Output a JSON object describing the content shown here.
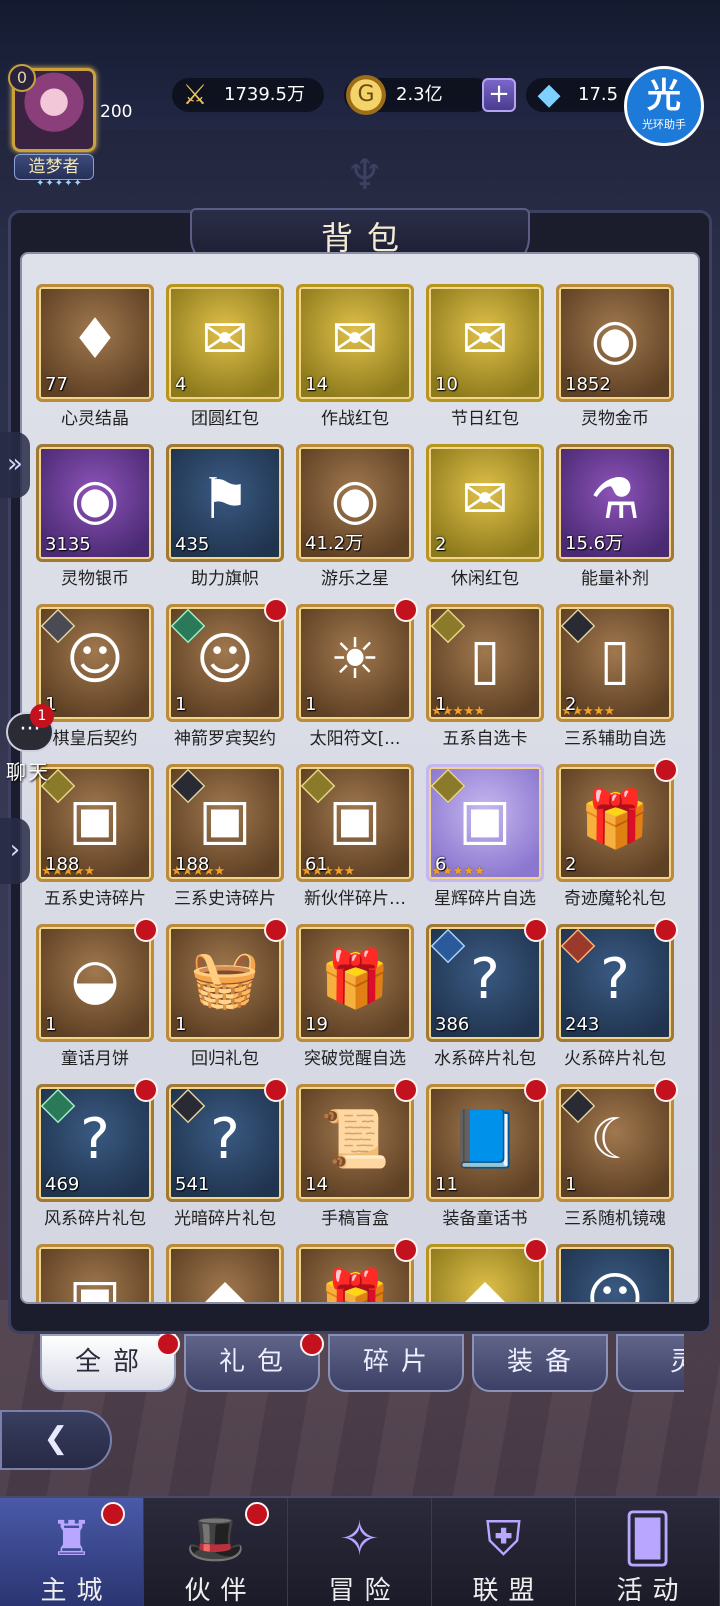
{
  "player": {
    "level": "0",
    "vip": "200",
    "title": "造梦者",
    "title_stars": "✦✦✦✦✦"
  },
  "resources": {
    "power": "1739.5万",
    "gold": "2.3亿",
    "gems": "17.5"
  },
  "helper_badge": {
    "glyph": "光",
    "label": "光环助手"
  },
  "panel": {
    "title": "背包"
  },
  "chat": {
    "count": "1",
    "label": "聊天"
  },
  "items": [
    {
      "label": "心灵结晶",
      "qty": "77",
      "style": "brown",
      "icon": "♦",
      "icon_name": "crystal-icon"
    },
    {
      "label": "团圆红包",
      "qty": "4",
      "style": "gold",
      "icon": "✉",
      "icon_name": "red-envelope-icon"
    },
    {
      "label": "作战红包",
      "qty": "14",
      "style": "gold",
      "icon": "✉",
      "icon_name": "red-envelope-icon"
    },
    {
      "label": "节日红包",
      "qty": "10",
      "style": "gold",
      "icon": "✉",
      "icon_name": "red-envelope-icon"
    },
    {
      "label": "灵物金币",
      "qty": "1852",
      "style": "brown",
      "icon": "◉",
      "icon_name": "gold-coin-icon"
    },
    {
      "label": "灵物银币",
      "qty": "3135",
      "style": "purple",
      "icon": "◉",
      "icon_name": "silver-coin-icon"
    },
    {
      "label": "助力旗帜",
      "qty": "435",
      "style": "blue",
      "icon": "⚑",
      "icon_name": "flag-icon"
    },
    {
      "label": "游乐之星",
      "qty": "41.2万",
      "style": "brown",
      "icon": "◉",
      "icon_name": "star-coin-icon"
    },
    {
      "label": "休闲红包",
      "qty": "2",
      "style": "gold",
      "icon": "✉",
      "icon_name": "red-envelope-icon"
    },
    {
      "label": "能量补剂",
      "qty": "15.6万",
      "style": "purple",
      "icon": "⚗",
      "icon_name": "potion-icon"
    },
    {
      "label": "棋皇后契约",
      "qty": "1",
      "style": "brown",
      "icon": "☺",
      "icon_name": "contract-icon",
      "badge": "gray"
    },
    {
      "label": "神箭罗宾契约",
      "qty": "1",
      "style": "brown",
      "icon": "☺",
      "icon_name": "contract-icon",
      "badge": "green",
      "dot": true
    },
    {
      "label": "太阳符文[...",
      "qty": "1",
      "style": "brown",
      "icon": "☀",
      "icon_name": "sun-rune-icon",
      "dot": true
    },
    {
      "label": "五系自选卡",
      "qty": "1",
      "style": "brown",
      "icon": "▯",
      "icon_name": "card-icon",
      "badge": "gold",
      "stars": "★★★★★"
    },
    {
      "label": "三系辅助自选",
      "qty": "2",
      "style": "brown",
      "icon": "▯",
      "icon_name": "card-icon",
      "badge": "dark",
      "stars": "★★★★★"
    },
    {
      "label": "五系史诗碎片",
      "qty": "188",
      "style": "brown",
      "icon": "▣",
      "icon_name": "chest-icon",
      "badge": "gold",
      "stars": "★★★★★"
    },
    {
      "label": "三系史诗碎片",
      "qty": "188",
      "style": "brown",
      "icon": "▣",
      "icon_name": "chest-icon",
      "badge": "dark",
      "stars": "★★★★★"
    },
    {
      "label": "新伙伴碎片…",
      "qty": "61",
      "style": "brown",
      "icon": "▣",
      "icon_name": "chest-icon",
      "badge": "gold",
      "stars": "★★★★★"
    },
    {
      "label": "星辉碎片自选",
      "qty": "6",
      "style": "lavender",
      "icon": "▣",
      "icon_name": "chest-icon",
      "badge": "gold",
      "stars": "★★★★★"
    },
    {
      "label": "奇迹魔轮礼包",
      "qty": "2",
      "style": "brown",
      "icon": "🎁",
      "icon_name": "gift-box-icon",
      "dot": true
    },
    {
      "label": "童话月饼",
      "qty": "1",
      "style": "brown",
      "icon": "◒",
      "icon_name": "mooncake-icon",
      "dot": true
    },
    {
      "label": "回归礼包",
      "qty": "1",
      "style": "brown",
      "icon": "🧺",
      "icon_name": "basket-icon",
      "dot": true
    },
    {
      "label": "突破觉醒自选",
      "qty": "19",
      "style": "brown",
      "icon": "🎁",
      "icon_name": "gift-box-icon"
    },
    {
      "label": "水系碎片礼包",
      "qty": "386",
      "style": "blue",
      "icon": "?",
      "icon_name": "mystery-shard-icon",
      "badge": "blue",
      "dot": true
    },
    {
      "label": "火系碎片礼包",
      "qty": "243",
      "style": "blue",
      "icon": "?",
      "icon_name": "mystery-shard-icon",
      "badge": "red",
      "dot": true
    },
    {
      "label": "风系碎片礼包",
      "qty": "469",
      "style": "blue",
      "icon": "?",
      "icon_name": "mystery-shard-icon",
      "badge": "green",
      "dot": true
    },
    {
      "label": "光暗碎片礼包",
      "qty": "541",
      "style": "blue",
      "icon": "?",
      "icon_name": "mystery-shard-icon",
      "badge": "dark",
      "dot": true
    },
    {
      "label": "手稿盲盒",
      "qty": "14",
      "style": "brown",
      "icon": "📜",
      "icon_name": "scroll-icon",
      "dot": true
    },
    {
      "label": "装备童话书",
      "qty": "11",
      "style": "brown",
      "icon": "📘",
      "icon_name": "book-icon",
      "dot": true
    },
    {
      "label": "三系随机镜魂",
      "qty": "1",
      "style": "brown",
      "icon": "☾",
      "icon_name": "mirror-soul-icon",
      "badge": "dark",
      "dot": true
    },
    {
      "label": "",
      "qty": "",
      "style": "brown",
      "icon": "▣",
      "icon_name": "chest-icon"
    },
    {
      "label": "",
      "qty": "",
      "style": "brown",
      "icon": "◆",
      "icon_name": "item-icon"
    },
    {
      "label": "",
      "qty": "",
      "style": "brown",
      "icon": "🎁",
      "icon_name": "gift-box-icon",
      "dot": true
    },
    {
      "label": "",
      "qty": "",
      "style": "gold",
      "icon": "◆",
      "icon_name": "item-icon",
      "dot": true
    },
    {
      "label": "",
      "qty": "",
      "style": "blue",
      "icon": "☺",
      "icon_name": "hero-icon"
    }
  ],
  "tabs": [
    {
      "label": "全部",
      "active": true,
      "dot": true
    },
    {
      "label": "礼包",
      "active": false,
      "dot": true
    },
    {
      "label": "碎片",
      "active": false,
      "dot": false
    },
    {
      "label": "装备",
      "active": false,
      "dot": false
    },
    {
      "label": "灵",
      "active": false,
      "dot": false
    }
  ],
  "nav": [
    {
      "label": "主城",
      "icon": "♜",
      "icon_name": "castle-icon",
      "active": true,
      "dot": true
    },
    {
      "label": "伙伴",
      "icon": "🎩",
      "icon_name": "witch-hat-icon",
      "active": false,
      "dot": true
    },
    {
      "label": "冒险",
      "icon": "✧",
      "icon_name": "adventure-portal-icon",
      "active": false,
      "dot": false
    },
    {
      "label": "联盟",
      "icon": "⛨",
      "icon_name": "alliance-shield-icon",
      "active": false,
      "dot": false
    },
    {
      "label": "活动",
      "icon": "🂠",
      "icon_name": "cards-icon",
      "active": false,
      "dot": false
    }
  ]
}
